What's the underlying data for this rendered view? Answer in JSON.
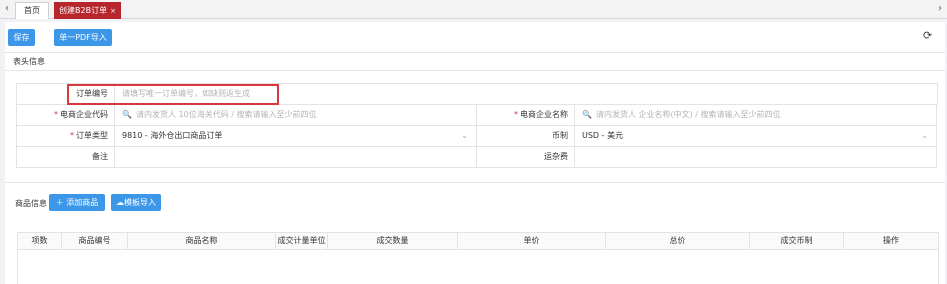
{
  "tabs": {
    "left_arrow": "‹",
    "right_arrow": "›",
    "home_label": "首页",
    "active_label": "创建B2B订单",
    "close_glyph": "×"
  },
  "toolbar": {
    "save_label": "保存",
    "pdf_import_label": "单一PDF导入",
    "refresh_glyph": "⟳"
  },
  "header_section": {
    "title": "表头信息",
    "order_no_label": "订单编号",
    "order_no_placeholder": "请填写唯一订单编号，如缺则返生成",
    "ecom_code_label": "电商企业代码",
    "ecom_code_placeholder": "请内发货人 10位海关代码 / 搜索请输入至少前四位",
    "ecom_name_label": "电商企业名称",
    "ecom_name_placeholder": "请内发货人 企业名称(中文) / 搜索请输入至少前四位",
    "order_type_label": "订单类型",
    "order_type_value": "9810 - 海外仓出口商品订单",
    "currency_label": "币制",
    "currency_value": "USD - 美元",
    "remark_label": "备注",
    "freight_label": "运杂费",
    "required_mark": "*",
    "search_glyph": "🔍",
    "chevron_glyph": "⌄"
  },
  "goods_section": {
    "title": "商品信息",
    "add_label": "＋ 添加商品",
    "template_import_label": "☁模板导入",
    "columns": [
      "项数",
      "商品编号",
      "商品名称",
      "成交计量单位",
      "成交数量",
      "单价",
      "总价",
      "成交币制",
      "操作"
    ]
  }
}
